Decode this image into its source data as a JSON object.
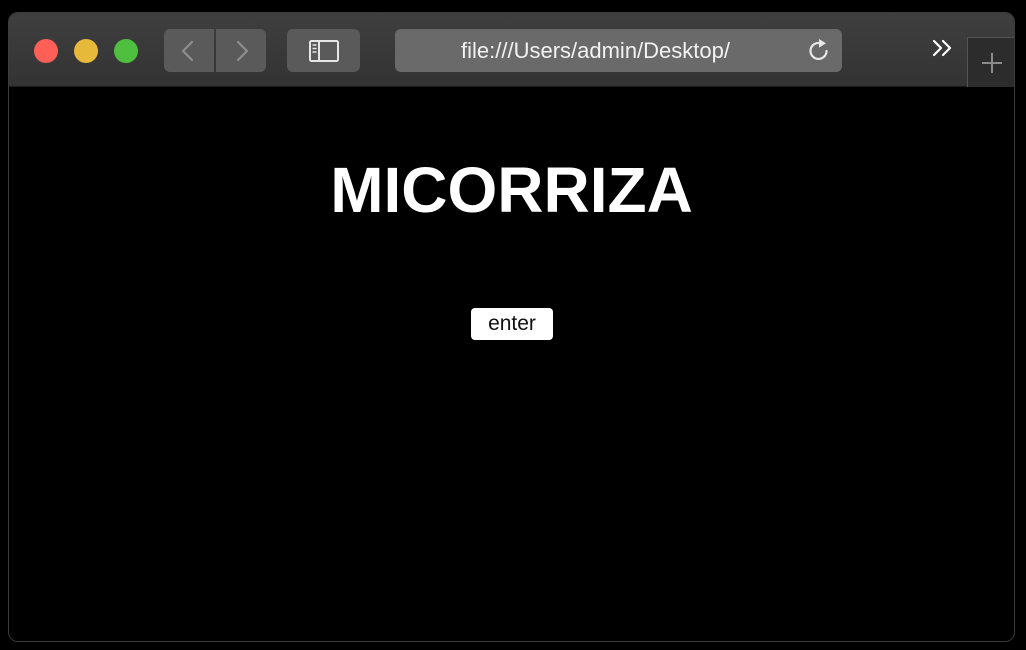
{
  "browser": {
    "url": "file:///Users/admin/Desktop/",
    "icons": {
      "close": "close-dot",
      "minimize": "minimize-dot",
      "zoom": "zoom-dot",
      "back": "chevron-left-icon",
      "forward": "chevron-right-icon",
      "sidebar": "sidebar-icon",
      "reload": "reload-icon",
      "more": "double-chevron-right-icon",
      "new_tab": "plus-icon"
    },
    "colors": {
      "close": "#fe5f57",
      "minimize": "#e6b93a",
      "zoom": "#4fbf3f",
      "chrome": "#3a3a3a"
    }
  },
  "page": {
    "title": "MICORRIZA",
    "enter_label": "enter",
    "background": "#000000",
    "text_color": "#ffffff"
  }
}
